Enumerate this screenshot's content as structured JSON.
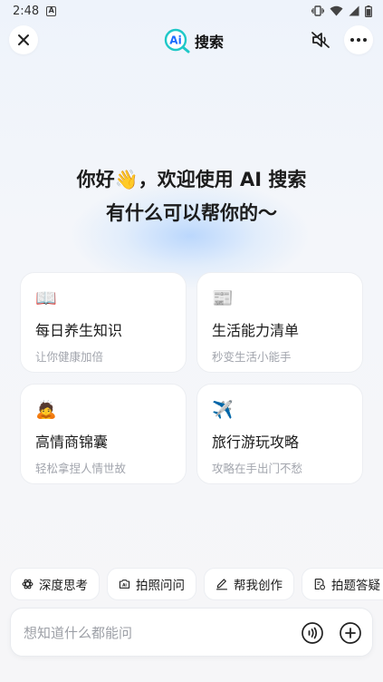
{
  "status": {
    "time": "2:48",
    "notification_icon": "a-icon"
  },
  "header": {
    "brand_logo_text": "Ai",
    "brand_title": "搜索"
  },
  "hero": {
    "line1": "你好👋，欢迎使用 AI 搜索",
    "line2": "有什么可以帮你的～"
  },
  "cards": [
    {
      "icon": "📖",
      "title": "每日养生知识",
      "subtitle": "让你健康加倍"
    },
    {
      "icon": "📰",
      "title": "生活能力清单",
      "subtitle": "秒变生活小能手"
    },
    {
      "icon": "🙇",
      "title": "高情商锦囊",
      "subtitle": "轻松拿捏人情世故"
    },
    {
      "icon": "✈️",
      "title": "旅行游玩攻略",
      "subtitle": "攻略在手出门不愁"
    }
  ],
  "chips": [
    {
      "icon": "atom-icon",
      "label": "深度思考"
    },
    {
      "icon": "camera-ai-icon",
      "label": "拍照问问"
    },
    {
      "icon": "pen-icon",
      "label": "帮我创作"
    },
    {
      "icon": "document-question-icon",
      "label": "拍题答疑"
    }
  ],
  "input": {
    "placeholder": "想知道什么都能问",
    "value": ""
  },
  "colors": {
    "accent": "#1ec8c8",
    "logo_blue": "#1a6cff",
    "background": "#f4f6fa"
  }
}
